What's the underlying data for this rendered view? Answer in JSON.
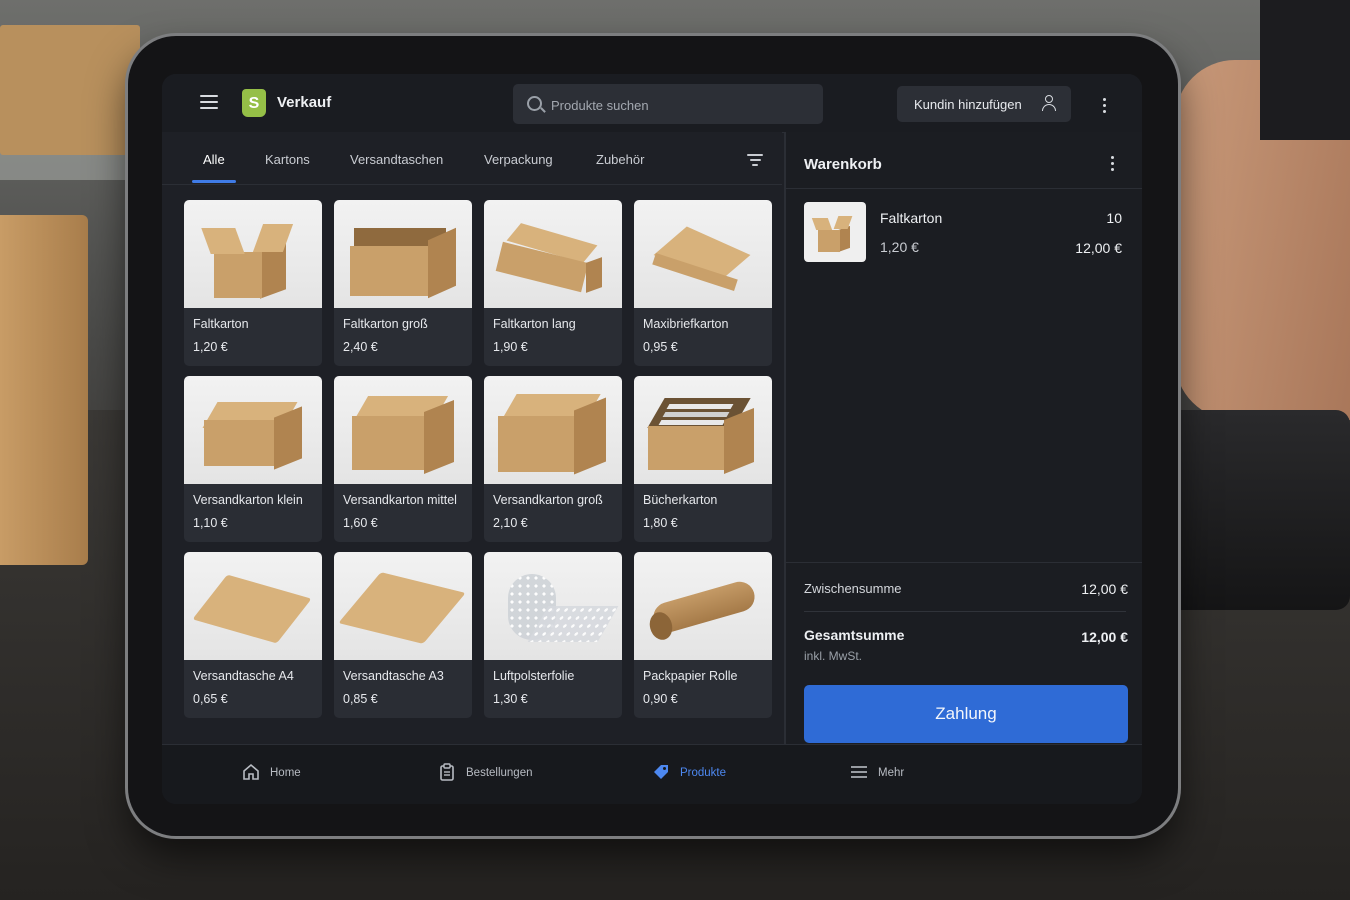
{
  "topbar": {
    "title": "Verkauf",
    "search_placeholder": "Produkte suchen",
    "customer_button": "Kundin hinzufügen"
  },
  "tabs": [
    {
      "label": "Alle",
      "active": true
    },
    {
      "label": "Kartons",
      "active": false
    },
    {
      "label": "Versandtaschen",
      "active": false
    },
    {
      "label": "Verpackung",
      "active": false
    },
    {
      "label": "Zubehör",
      "active": false
    }
  ],
  "products": [
    {
      "name": "Faltkarton",
      "price": "1,20 €",
      "icon": "open-box"
    },
    {
      "name": "Faltkarton groß",
      "price": "2,40 €",
      "icon": "open-box-large"
    },
    {
      "name": "Faltkarton lang",
      "price": "1,90 €",
      "icon": "long-box"
    },
    {
      "name": "Maxibriefkarton",
      "price": "0,95 €",
      "icon": "flat-box"
    },
    {
      "name": "Versandkarton klein",
      "price": "1,10 €",
      "icon": "closed-box"
    },
    {
      "name": "Versandkarton mittel",
      "price": "1,60 €",
      "icon": "closed-box"
    },
    {
      "name": "Versandkarton groß",
      "price": "2,10 €",
      "icon": "closed-box"
    },
    {
      "name": "Bücherkarton",
      "price": "1,80 €",
      "icon": "book-box"
    },
    {
      "name": "Versandtasche A4",
      "price": "0,65 €",
      "icon": "envelope"
    },
    {
      "name": "Versandtasche A3",
      "price": "0,85 €",
      "icon": "envelope"
    },
    {
      "name": "Luftpolsterfolie",
      "price": "1,30 €",
      "icon": "bubble-wrap"
    },
    {
      "name": "Packpapier Rolle",
      "price": "0,90 €",
      "icon": "paper-roll"
    }
  ],
  "cart": {
    "title": "Warenkorb",
    "items": [
      {
        "name": "Faltkarton",
        "unit_price": "1,20 €",
        "quantity": "10",
        "line_total": "12,00 €"
      }
    ],
    "subtotal_label": "Zwischensumme",
    "subtotal_value": "12,00 €",
    "total_label": "Gesamtsumme",
    "total_value": "12,00 €",
    "tax_note": "inkl. MwSt.",
    "pay_button": "Zahlung"
  },
  "bottom_nav": [
    {
      "label": "Home",
      "icon": "home-icon",
      "active": false
    },
    {
      "label": "Bestellungen",
      "icon": "orders-icon",
      "active": false
    },
    {
      "label": "Produkte",
      "icon": "tag-icon",
      "active": true
    },
    {
      "label": "Mehr",
      "icon": "menu-icon",
      "active": false
    }
  ],
  "colors": {
    "accent": "#2f6bd6",
    "nav_active": "#4d88f0",
    "brand": "#95bf47",
    "screen_bg": "#1e2026"
  }
}
